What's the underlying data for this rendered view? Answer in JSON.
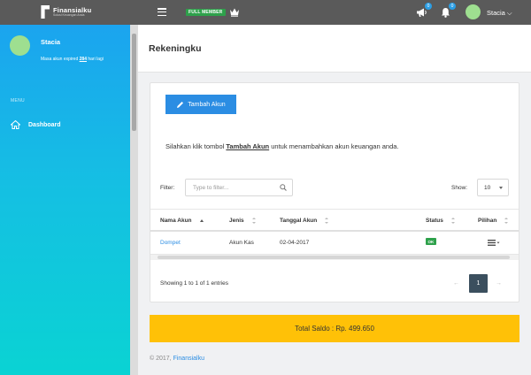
{
  "topbar": {
    "brand": "Finansialku",
    "brand_tagline": "Solusi Keuangan Anda",
    "member_badge": "FULL MEMBER",
    "announcements_count": "0",
    "notifications_count": "0",
    "user_name": "Stacia ⌵"
  },
  "sidebar": {
    "user_name": "Stacia",
    "expire_prefix": "Masa akun expired",
    "expire_days": "284",
    "expire_suffix": "hari lagi",
    "menu_label": "MENU",
    "items": [
      {
        "label": "Dashboard",
        "icon": "home-icon"
      }
    ]
  },
  "page": {
    "title": "Rekeningku"
  },
  "card": {
    "add_button": "Tambah Akun",
    "intro_prefix": "Silahkan klik tombol ",
    "intro_bold": "Tambah Akun",
    "intro_suffix": " untuk menambahkan akun keuangan anda.",
    "filter_label": "Filter:",
    "filter_placeholder": "Type to filter...",
    "show_label": "Show:",
    "show_value": "10",
    "columns": [
      "Nama Akun",
      "Jenis",
      "Tanggal Akun",
      "Status",
      "Pilihan"
    ],
    "rows": [
      {
        "nama": "Dompet",
        "jenis": "Akun Kas",
        "tanggal": "02-04-2017",
        "status": "OK"
      }
    ],
    "info": "Showing 1 to 1 of 1 entries",
    "pagination": {
      "prev": "←",
      "current": "1",
      "next": "→"
    }
  },
  "total": {
    "label": "Total Saldo : Rp. 499.650"
  },
  "footer": {
    "copyright": "© 2017, ",
    "link": "Finansialku"
  },
  "colors": {
    "topbar": "#5a5a5a",
    "primary": "#2b8de3",
    "success": "#2ea14b",
    "warning": "#ffc107",
    "sidebar_top": "#1ba4ef",
    "sidebar_bottom": "#0ad3d3"
  }
}
